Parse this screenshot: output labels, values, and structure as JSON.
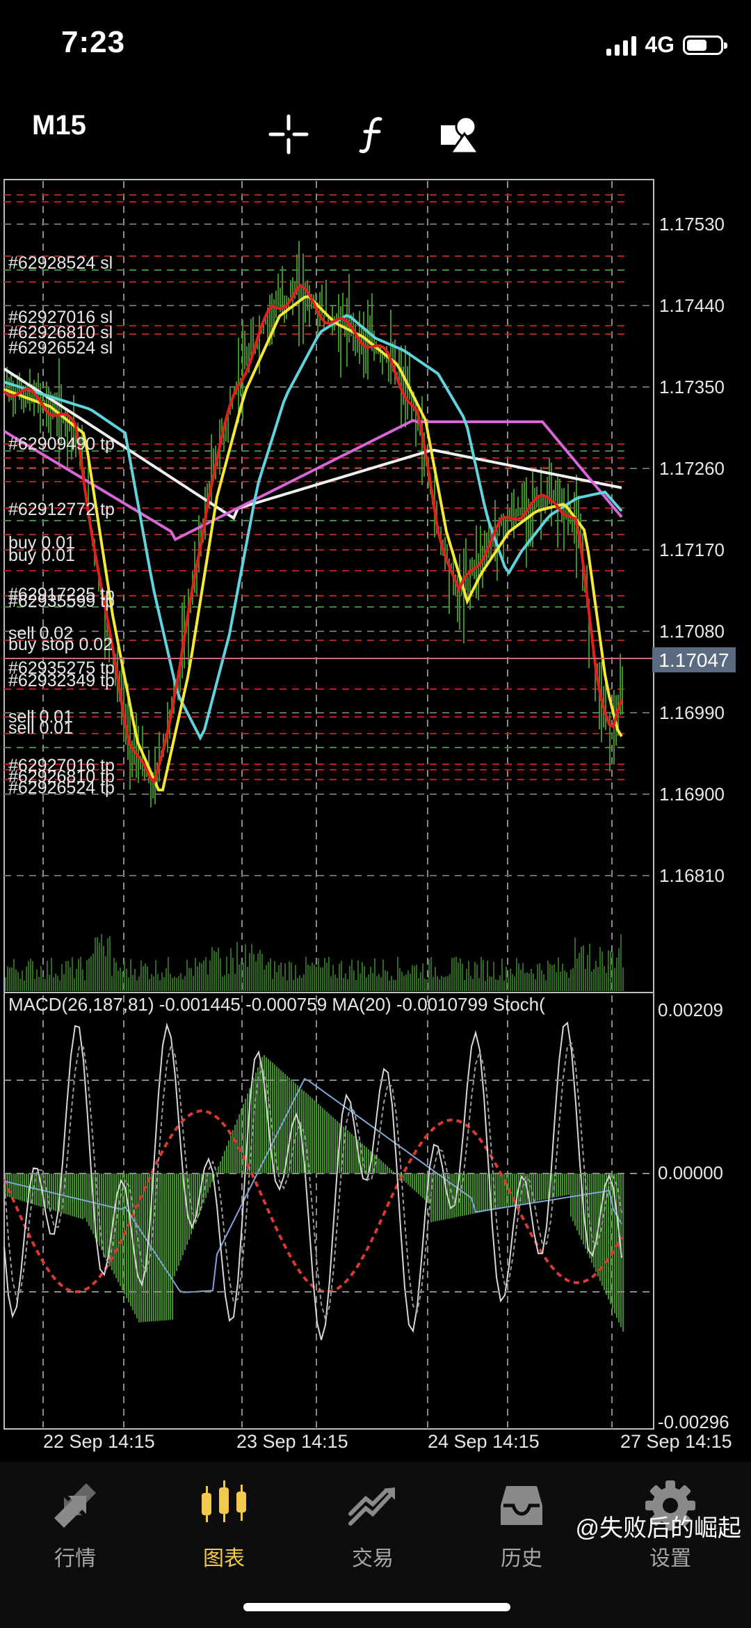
{
  "status": {
    "time": "7:23",
    "network": "4G",
    "battery_level": 0.6
  },
  "toolbar": {
    "timeframe": "M15",
    "icons": [
      "crosshair-icon",
      "function-icon",
      "objects-icon"
    ]
  },
  "price_axis": {
    "labels": [
      "1.17530",
      "1.17440",
      "1.17350",
      "1.17260",
      "1.17170",
      "1.17080",
      "1.16990",
      "1.16900",
      "1.16810"
    ],
    "current_price": "1.17047"
  },
  "order_labels": [
    "#62928524 sl",
    "#62927016 sl",
    "#62926810 sl",
    "#62926524 sl",
    "#62909490 tp",
    "#62912772 tp",
    "buy 0.01",
    "buy 0.01",
    "#62917225 tp",
    "#62935599 tp",
    "sell 0.02",
    "buy stop 0.02",
    "#62935275 tp",
    "#62932349 tp",
    "sell 0.01",
    "sell 0.01",
    "#62927016 tp",
    "#62926810 tp",
    "#62926524 tp"
  ],
  "indicator": {
    "header": "MACD(26,187,81) -0.001445 -0.000759 MA(20) -0.0010799 Stoch(",
    "axis_labels": [
      "0.00209",
      "0.00000",
      "-0.00296"
    ]
  },
  "time_axis": [
    "22 Sep 14:15",
    "23 Sep 14:15",
    "24 Sep 14:15",
    "27 Sep 14:15"
  ],
  "colors": {
    "accent": "#f2c94c",
    "candle": "#3f8f2a",
    "ma_red": "#e0201e",
    "ma_yellow": "#f5e836",
    "ma_cyan": "#5fd4dc",
    "ma_magenta": "#d965d6",
    "ma_white": "#f0f0f0",
    "current_price_bg": "#5a6a80"
  },
  "nav": [
    {
      "label": "行情",
      "icon": "quotes-icon"
    },
    {
      "label": "图表",
      "icon": "chart-icon"
    },
    {
      "label": "交易",
      "icon": "trade-icon"
    },
    {
      "label": "历史",
      "icon": "history-icon"
    },
    {
      "label": "设置",
      "icon": "settings-icon"
    }
  ],
  "watermark": "@失败后的崛起"
}
